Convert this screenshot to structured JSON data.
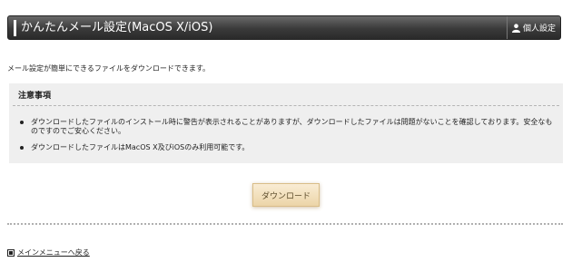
{
  "header": {
    "title": "かんたんメール設定(MacOS X/iOS)",
    "personal_label": "個人設定"
  },
  "intro": "メール設定が簡単にできるファイルをダウンロードできます。",
  "notice": {
    "title": "注意事項",
    "items": [
      "ダウンロードしたファイルのインストール時に警告が表示されることがありますが、ダウンロードしたファイルは問題がないことを確認しております。安全なものですのでご安心ください。",
      "ダウンロードしたファイルはMacOS X及びiOSのみ利用可能です。"
    ]
  },
  "download_button": "ダウンロード",
  "back_link": "メインメニューへ戻る",
  "colors": {
    "header_bg": "#3a3a3a",
    "notice_bg": "#efefef",
    "button_bg": "#f3e0bc"
  },
  "icons": {
    "personal": "person-icon",
    "back": "square-bullet-icon"
  }
}
